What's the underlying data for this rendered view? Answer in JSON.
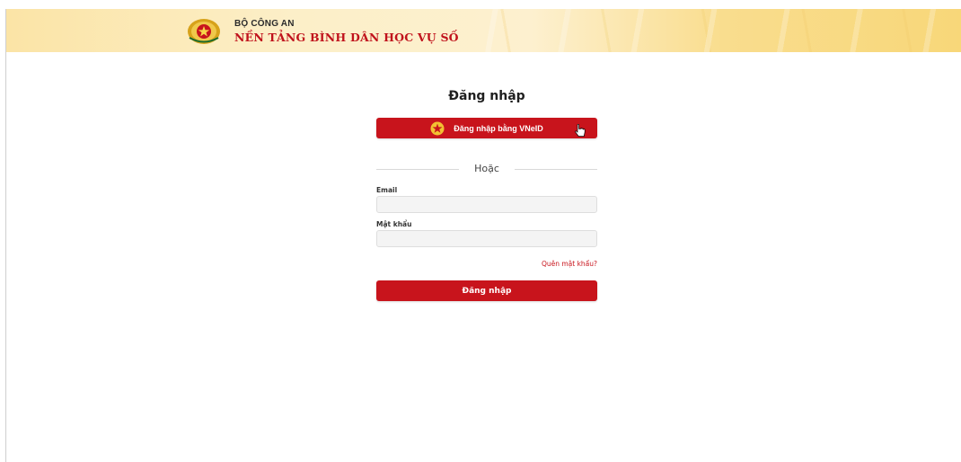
{
  "header": {
    "brand_top": "BỘ CÔNG AN",
    "brand_main": "NỀN TẢNG BÌNH DÂN HỌC VỤ SỐ",
    "logo_icon": "police-emblem-icon"
  },
  "login": {
    "title": "Đăng nhập",
    "vneid_button": "Đăng nhập bằng VNeID",
    "divider_text": "Hoặc",
    "email_label": "Email",
    "email_value": "",
    "password_label": "Mật khẩu",
    "password_value": "",
    "forgot_link": "Quên mật khẩu?",
    "submit_button": "Đăng nhập"
  },
  "colors": {
    "accent_red": "#c8141c",
    "header_gold": "#f8d779"
  }
}
